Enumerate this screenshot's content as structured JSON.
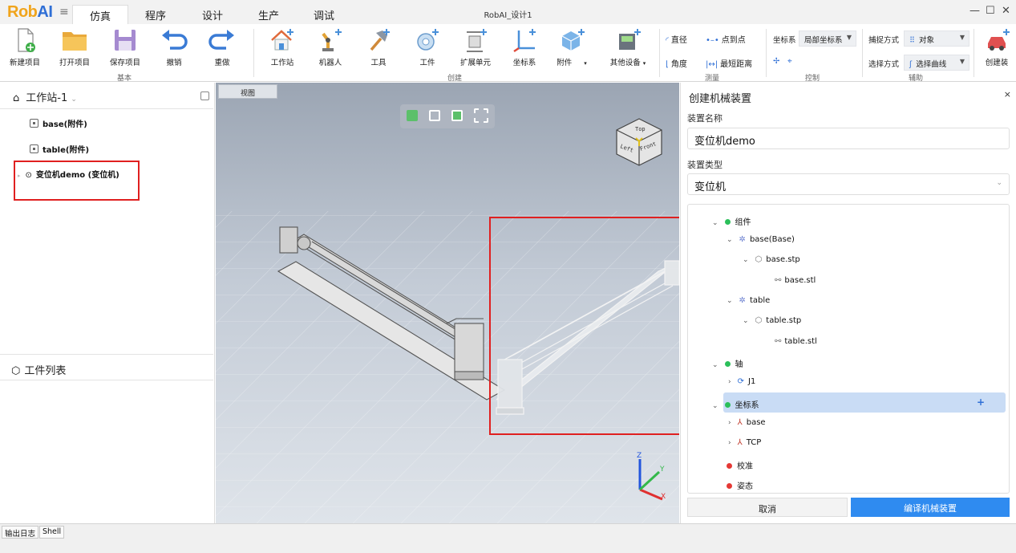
{
  "app": {
    "logo_main": "Rob",
    "logo_accent": "AI",
    "window_title": "RobAI_设计1",
    "win_min": "—",
    "win_max": "☐",
    "win_close": "✕"
  },
  "tabs": [
    {
      "label": "仿真",
      "active": true
    },
    {
      "label": "程序"
    },
    {
      "label": "设计"
    },
    {
      "label": "生产"
    },
    {
      "label": "调试"
    }
  ],
  "ribbon": {
    "groups": {
      "basic": "基本",
      "create": "创建",
      "measure": "测量",
      "control": "控制",
      "assist": "辅助"
    },
    "buttons": {
      "new_project": "新建项目",
      "open_project": "打开项目",
      "save_project": "保存项目",
      "undo": "撤销",
      "redo": "重做",
      "workstation": "工作站",
      "robot": "机器人",
      "tool": "工具",
      "workpiece": "工件",
      "extension_unit": "扩展单元",
      "frame": "坐标系",
      "attachment": "附件",
      "other_devices": "其他设备",
      "create_device": "创建装"
    },
    "measure": {
      "diameter": "直径",
      "point_to_point": "点到点",
      "angle": "角度",
      "shortest_distance": "最短距离"
    },
    "control": {
      "frame_label": "坐标系",
      "frame_value": "局部坐标系"
    },
    "assist": {
      "snap_label": "捕捉方式",
      "snap_value": "对象",
      "select_label": "选择方式",
      "select_value": "选择曲线"
    }
  },
  "left_panel": {
    "station": "工作站-1",
    "items": [
      {
        "label": "base(附件)"
      },
      {
        "label": "table(附件)"
      },
      {
        "label": "变位机demo (变位机)"
      }
    ],
    "parts_list": "工件列表"
  },
  "viewport": {
    "tab": "视图",
    "cube_top": "Top",
    "cube_left": "Left",
    "cube_front": "Front",
    "axis_x": "X",
    "axis_y": "Y",
    "axis_z": "Z"
  },
  "right_panel": {
    "title": "创建机械装置",
    "close": "×",
    "name_label": "装置名称",
    "name_value": "变位机demo",
    "type_label": "装置类型",
    "type_value": "变位机",
    "tree": {
      "components": "组件",
      "base": "base(Base)",
      "base_stp": "base.stp",
      "base_stl": "base.stl",
      "table": "table",
      "table_stp": "table.stp",
      "table_stl": "table.stl",
      "axes": "轴",
      "j1": "J1",
      "frames": "坐标系",
      "frame_base": "base",
      "frame_tcp": "TCP",
      "calibration": "校准",
      "pose": "姿态"
    },
    "cancel": "取消",
    "compile": "编译机械装置"
  },
  "bottom": {
    "output_log": "输出日志",
    "shell": "Shell"
  }
}
